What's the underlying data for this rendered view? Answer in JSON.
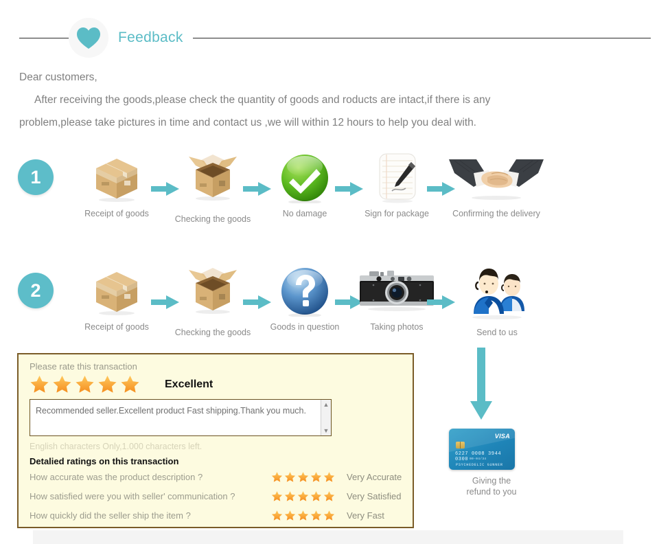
{
  "header": {
    "title": "Feedback",
    "heart_icon": "heart-icon",
    "accent_color": "#5bbcc6"
  },
  "intro": {
    "line1": "Dear customers,",
    "line2": "After receiving the goods,please check the quantity of goods and roducts are intact,if there is any",
    "line3": "problem,please take pictures in time and contact us ,we will within 12 hours to help you deal with."
  },
  "steps": [
    {
      "number": "1",
      "cells": [
        {
          "caption": "Receipt of goods",
          "icon": "closed-box-icon"
        },
        {
          "caption": "Checking the goods",
          "icon": "open-box-icon"
        },
        {
          "caption": "No damage",
          "icon": "green-check-icon"
        },
        {
          "caption": "Sign for package",
          "icon": "signed-paper-icon"
        },
        {
          "caption": "Confirming the delivery",
          "icon": "handshake-icon"
        }
      ]
    },
    {
      "number": "2",
      "cells": [
        {
          "caption": "Receipt of goods",
          "icon": "closed-box-icon"
        },
        {
          "caption": "Checking the goods",
          "icon": "open-box-icon"
        },
        {
          "caption": "Goods in question",
          "icon": "blue-question-icon"
        },
        {
          "caption": "Taking photos",
          "icon": "camera-icon"
        },
        {
          "caption": "Send to us",
          "icon": "support-agents-icon"
        }
      ]
    }
  ],
  "feedback_box": {
    "rate_label": "Please rate this transaction",
    "star_count": 5,
    "rating_word": "Excellent",
    "comment": "Recommended seller.Excellent product Fast shipping.Thank you much.",
    "chars_left": "English characters Only,1.000 characters left.",
    "detail_heading": "Detalied ratings on this transaction",
    "detail_rows": [
      {
        "question": "How accurate was the product description ?",
        "stars": 5,
        "answer": "Very Accurate"
      },
      {
        "question": "How satisfied were you with seller' communication  ?",
        "stars": 5,
        "answer": "Very Satisfied"
      },
      {
        "question": "How quickly did the seller ship the item ?",
        "stars": 5,
        "answer": "Very Fast"
      }
    ],
    "border_color": "#7a5c28",
    "background_color": "#fdfbe0",
    "star_color": "#f7a824"
  },
  "refund": {
    "arrow_icon": "down-arrow-icon",
    "card": {
      "brand": "VISA",
      "number": "6227 0008 3944 0300",
      "expiry": "00-04/34",
      "holder": "PSYCHEDELIC GUNNER"
    },
    "caption_line1": "Giving the",
    "caption_line2": "refund to you"
  }
}
